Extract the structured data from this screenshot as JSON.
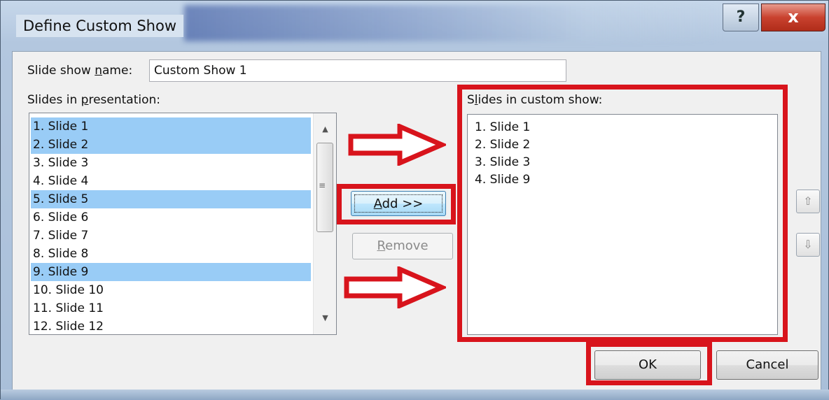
{
  "window": {
    "title": "Define Custom Show",
    "help_glyph": "?",
    "close_glyph": "x"
  },
  "form": {
    "name_label_pre": "Slide show ",
    "name_label_key": "n",
    "name_label_post": "ame:",
    "name_value": "Custom Show 1",
    "presentation_label_pre": "Slides in ",
    "presentation_label_key": "p",
    "presentation_label_post": "resentation:",
    "custom_label_pre": "S",
    "custom_label_key": "l",
    "custom_label_post": "ides in custom show:"
  },
  "presentation_slides": [
    {
      "label": "1. Slide 1",
      "selected": true
    },
    {
      "label": "2. Slide 2",
      "selected": true
    },
    {
      "label": "3. Slide 3",
      "selected": false
    },
    {
      "label": "4. Slide 4",
      "selected": false
    },
    {
      "label": "5. Slide 5",
      "selected": true
    },
    {
      "label": "6. Slide 6",
      "selected": false
    },
    {
      "label": "7. Slide 7",
      "selected": false
    },
    {
      "label": "8. Slide 8",
      "selected": false
    },
    {
      "label": "9. Slide 9",
      "selected": true
    },
    {
      "label": "10. Slide 10",
      "selected": false
    },
    {
      "label": "11. Slide 11",
      "selected": false
    },
    {
      "label": "12. Slide 12",
      "selected": false
    }
  ],
  "custom_slides": [
    "1. Slide 1",
    "2. Slide 2",
    "3. Slide 3",
    "4. Slide 9"
  ],
  "buttons": {
    "add_key": "A",
    "add_rest": "dd >>",
    "remove_key": "R",
    "remove_rest": "emove",
    "ok": "OK",
    "cancel": "Cancel",
    "move_up_icon": "up-arrow-icon",
    "move_down_icon": "down-arrow-icon"
  },
  "colors": {
    "selection": "#99ccf6",
    "annotation_red": "#d8141c",
    "close_red": "#c9422f"
  }
}
